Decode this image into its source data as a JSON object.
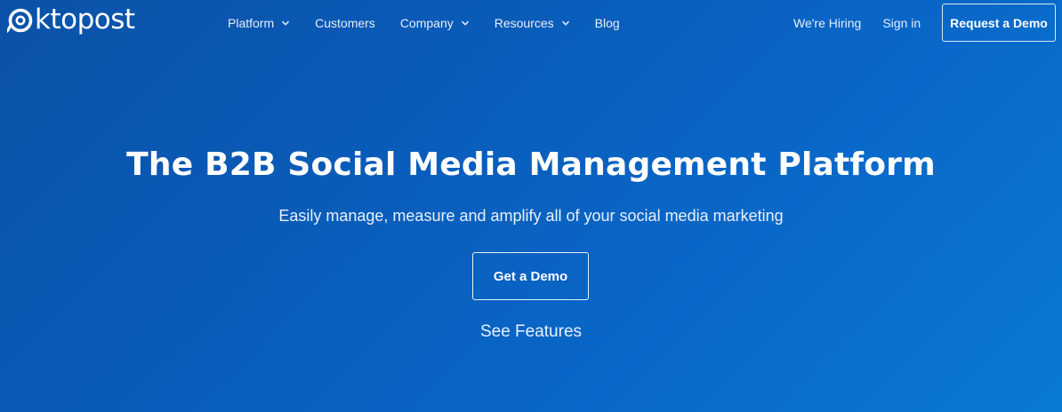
{
  "brand": {
    "logo_text": "ktopost",
    "logo_icon": "oktopost-swirl-icon"
  },
  "nav": {
    "items": [
      {
        "label": "Platform",
        "has_dropdown": true
      },
      {
        "label": "Customers",
        "has_dropdown": false
      },
      {
        "label": "Company",
        "has_dropdown": true
      },
      {
        "label": "Resources",
        "has_dropdown": true
      },
      {
        "label": "Blog",
        "has_dropdown": false
      }
    ],
    "hiring_label": "We're Hiring",
    "signin_label": "Sign in",
    "request_demo_label": "Request a Demo"
  },
  "hero": {
    "title": "The B2B Social Media Management Platform",
    "subtitle": "Easily manage, measure and amplify all of your social media marketing",
    "cta_label": "Get a Demo",
    "secondary_link": "See Features"
  },
  "colors": {
    "background_start": "#0b52a8",
    "background_end": "#0a7ad2",
    "text": "#ffffff"
  }
}
